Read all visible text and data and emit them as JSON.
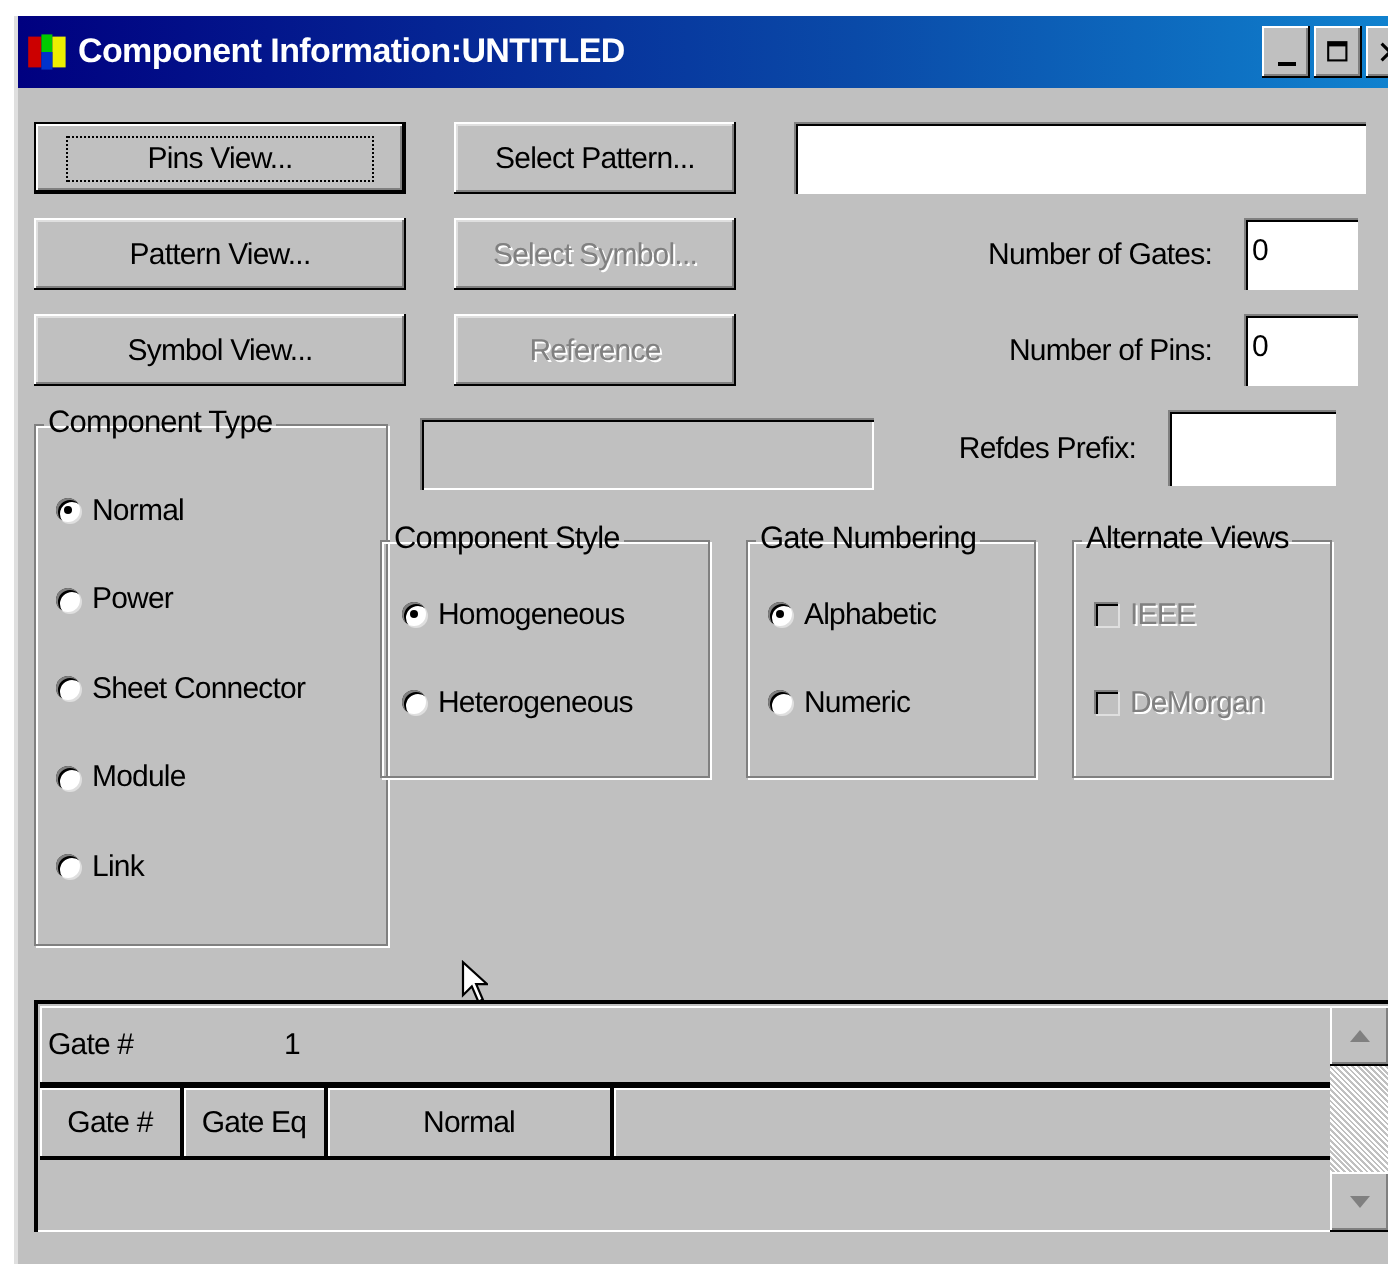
{
  "window": {
    "title": "Component Information:UNTITLED"
  },
  "buttons": [
    {
      "label": "Pins View...",
      "disabled": false,
      "focused": true
    },
    {
      "label": "Select Pattern...",
      "disabled": false,
      "focused": false
    },
    {
      "label": "Pattern View...",
      "disabled": false,
      "focused": false
    },
    {
      "label": "Select Symbol...",
      "disabled": true,
      "focused": false
    },
    {
      "label": "Symbol View...",
      "disabled": false,
      "focused": false
    },
    {
      "label": "Reference",
      "disabled": true,
      "focused": false
    }
  ],
  "number_of_gates": {
    "label": "Number of Gates:",
    "value": "0"
  },
  "number_of_pins": {
    "label": "Number of Pins:",
    "value": "0"
  },
  "refdes_prefix": {
    "label": "Refdes Prefix:"
  },
  "component_type": {
    "title": "Component Type",
    "options": [
      {
        "label": "Normal",
        "selected": true
      },
      {
        "label": "Power",
        "selected": false
      },
      {
        "label": "Sheet Connector",
        "selected": false
      },
      {
        "label": "Module",
        "selected": false
      },
      {
        "label": "Link",
        "selected": false
      }
    ]
  },
  "component_style": {
    "title": "Component Style",
    "options": [
      {
        "label": "Homogeneous",
        "selected": true
      },
      {
        "label": "Heterogeneous",
        "selected": false
      }
    ]
  },
  "gate_numbering": {
    "title": "Gate Numbering",
    "options": [
      {
        "label": "Alphabetic",
        "selected": true
      },
      {
        "label": "Numeric",
        "selected": false
      }
    ]
  },
  "alternate_views": {
    "title": "Alternate Views",
    "options": [
      {
        "label": "IEEE",
        "checked": false,
        "disabled": true
      },
      {
        "label": "DeMorgan",
        "checked": false,
        "disabled": true
      }
    ]
  },
  "gate_grid": {
    "header_label": "Gate #",
    "header_value": "1",
    "columns": [
      "Gate #",
      "Gate Eq",
      "Normal"
    ]
  }
}
